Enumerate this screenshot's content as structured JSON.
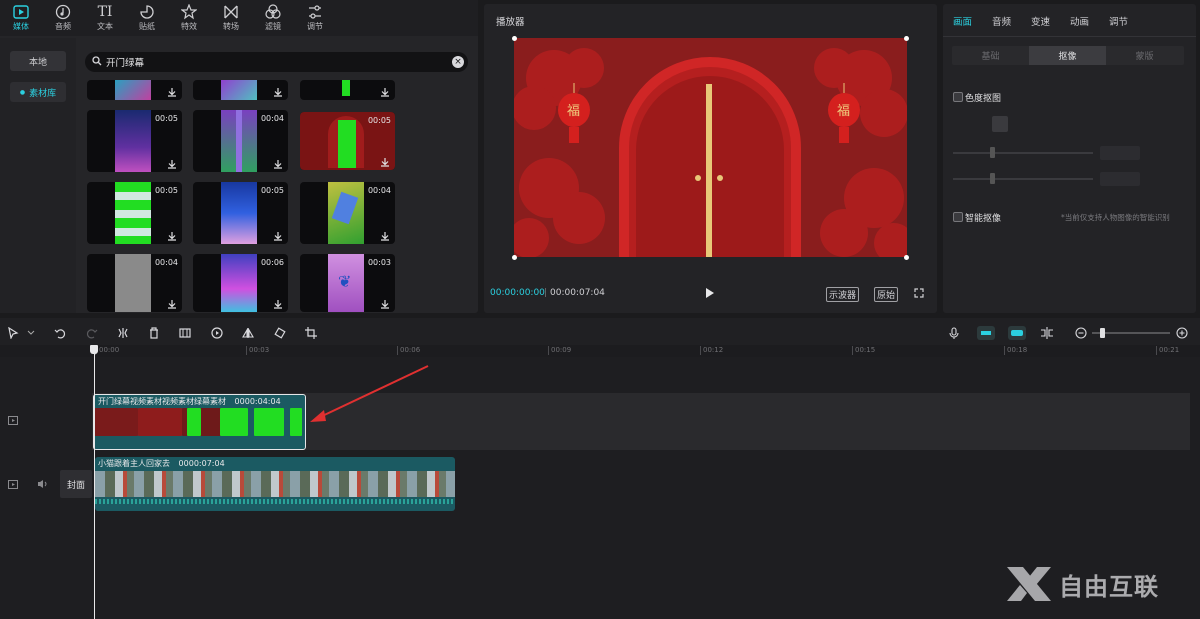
{
  "media_tabs": [
    {
      "label": "媒体",
      "icon": "media-icon",
      "active": true
    },
    {
      "label": "音频",
      "icon": "audio-icon"
    },
    {
      "label": "文本",
      "icon": "text-icon"
    },
    {
      "label": "贴纸",
      "icon": "sticker-icon"
    },
    {
      "label": "特效",
      "icon": "effects-icon"
    },
    {
      "label": "转场",
      "icon": "transition-icon"
    },
    {
      "label": "滤镜",
      "icon": "filter-icon"
    },
    {
      "label": "调节",
      "icon": "adjust-icon"
    }
  ],
  "sidebar": {
    "local": "本地",
    "library": "素材库"
  },
  "search": {
    "value": "开门绿幕"
  },
  "thumbs": [
    {
      "dur": "00:05",
      "bg": "#2a2050"
    },
    {
      "dur": "00:04",
      "bg": "#7a40a0"
    },
    {
      "dur": "00:05",
      "bg": "#7a1414"
    },
    {
      "dur": "00:05",
      "bg": "#30c030"
    },
    {
      "dur": "00:05",
      "bg": "#1838a0"
    },
    {
      "dur": "00:04",
      "bg": "#6a9a30"
    },
    {
      "dur": "00:04",
      "bg": "#8a8a8a"
    },
    {
      "dur": "00:06",
      "bg": "#b040c0"
    },
    {
      "dur": "00:03",
      "bg": "#c070d0"
    }
  ],
  "player": {
    "title": "播放器",
    "current_time": "00:00:00:00",
    "total_time": "00:00:07:04",
    "scope_label": "示波器",
    "original_label": "原始"
  },
  "inspector": {
    "tabs": [
      "画面",
      "音频",
      "变速",
      "动画",
      "调节"
    ],
    "segments": [
      "基础",
      "抠像",
      "蒙版"
    ],
    "chroma_key": "色度抠图",
    "smart_key": "智能抠像",
    "smart_note": "*当前仅支持人物图像的智能识别"
  },
  "timeline": {
    "ticks": [
      "00:00",
      "00:03",
      "00:06",
      "00:09",
      "00:12",
      "00:15",
      "00:18",
      "00:21"
    ],
    "clip1": {
      "name": "开门绿幕视频素材视频素材绿幕素材",
      "duration": "0000:04:04"
    },
    "clip2": {
      "name": "小猫跟着主人回家去",
      "duration": "0000:07:04"
    },
    "cover_label": "封面"
  },
  "watermark": {
    "text": "自由互联"
  },
  "colors": {
    "accent": "#2bd0e0",
    "green": "#22dd22",
    "clip_teal": "#1b5a62"
  }
}
